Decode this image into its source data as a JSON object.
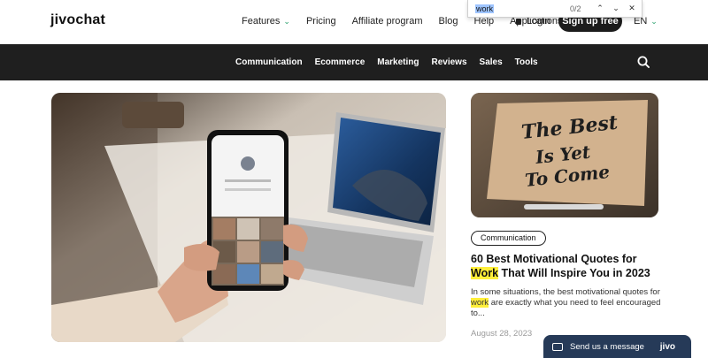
{
  "header": {
    "logo": "jivochat",
    "nav": [
      {
        "label": "Features",
        "has_dropdown": true
      },
      {
        "label": "Pricing"
      },
      {
        "label": "Affiliate program"
      },
      {
        "label": "Blog"
      },
      {
        "label": "Help"
      },
      {
        "label": "Applications"
      }
    ],
    "login_label": "Login",
    "signup_label": "Sign up free",
    "language": "EN"
  },
  "find_bar": {
    "query": "work",
    "count": "0/2",
    "prev_icon": "chevron-up-icon",
    "next_icon": "chevron-down-icon",
    "close_icon": "close-icon"
  },
  "categories": [
    "Communication",
    "Ecommerce",
    "Marketing",
    "Reviews",
    "Sales",
    "Tools"
  ],
  "featured_article": {
    "image_icon": "hand-holding-phone-photo"
  },
  "side_article": {
    "image_text": "The Best Is Yet To Come",
    "badge": "Communication",
    "title_before": "60  Best Motivational Quotes for ",
    "title_highlight": "Work",
    "title_after": " That Will Inspire You in 2023",
    "excerpt_before": "In some situations, the best motivational quotes for ",
    "excerpt_highlight": "work",
    "excerpt_after": " are exactly what you need to feel encouraged to...",
    "date": "August 28, 2023"
  },
  "chat_widget": {
    "label": "Send us a message",
    "brand": "jivo"
  },
  "colors": {
    "accent": "#2aa16d",
    "dark": "#1f1f1f",
    "highlight": "#ffef3a",
    "chat_bg": "#263a58"
  }
}
